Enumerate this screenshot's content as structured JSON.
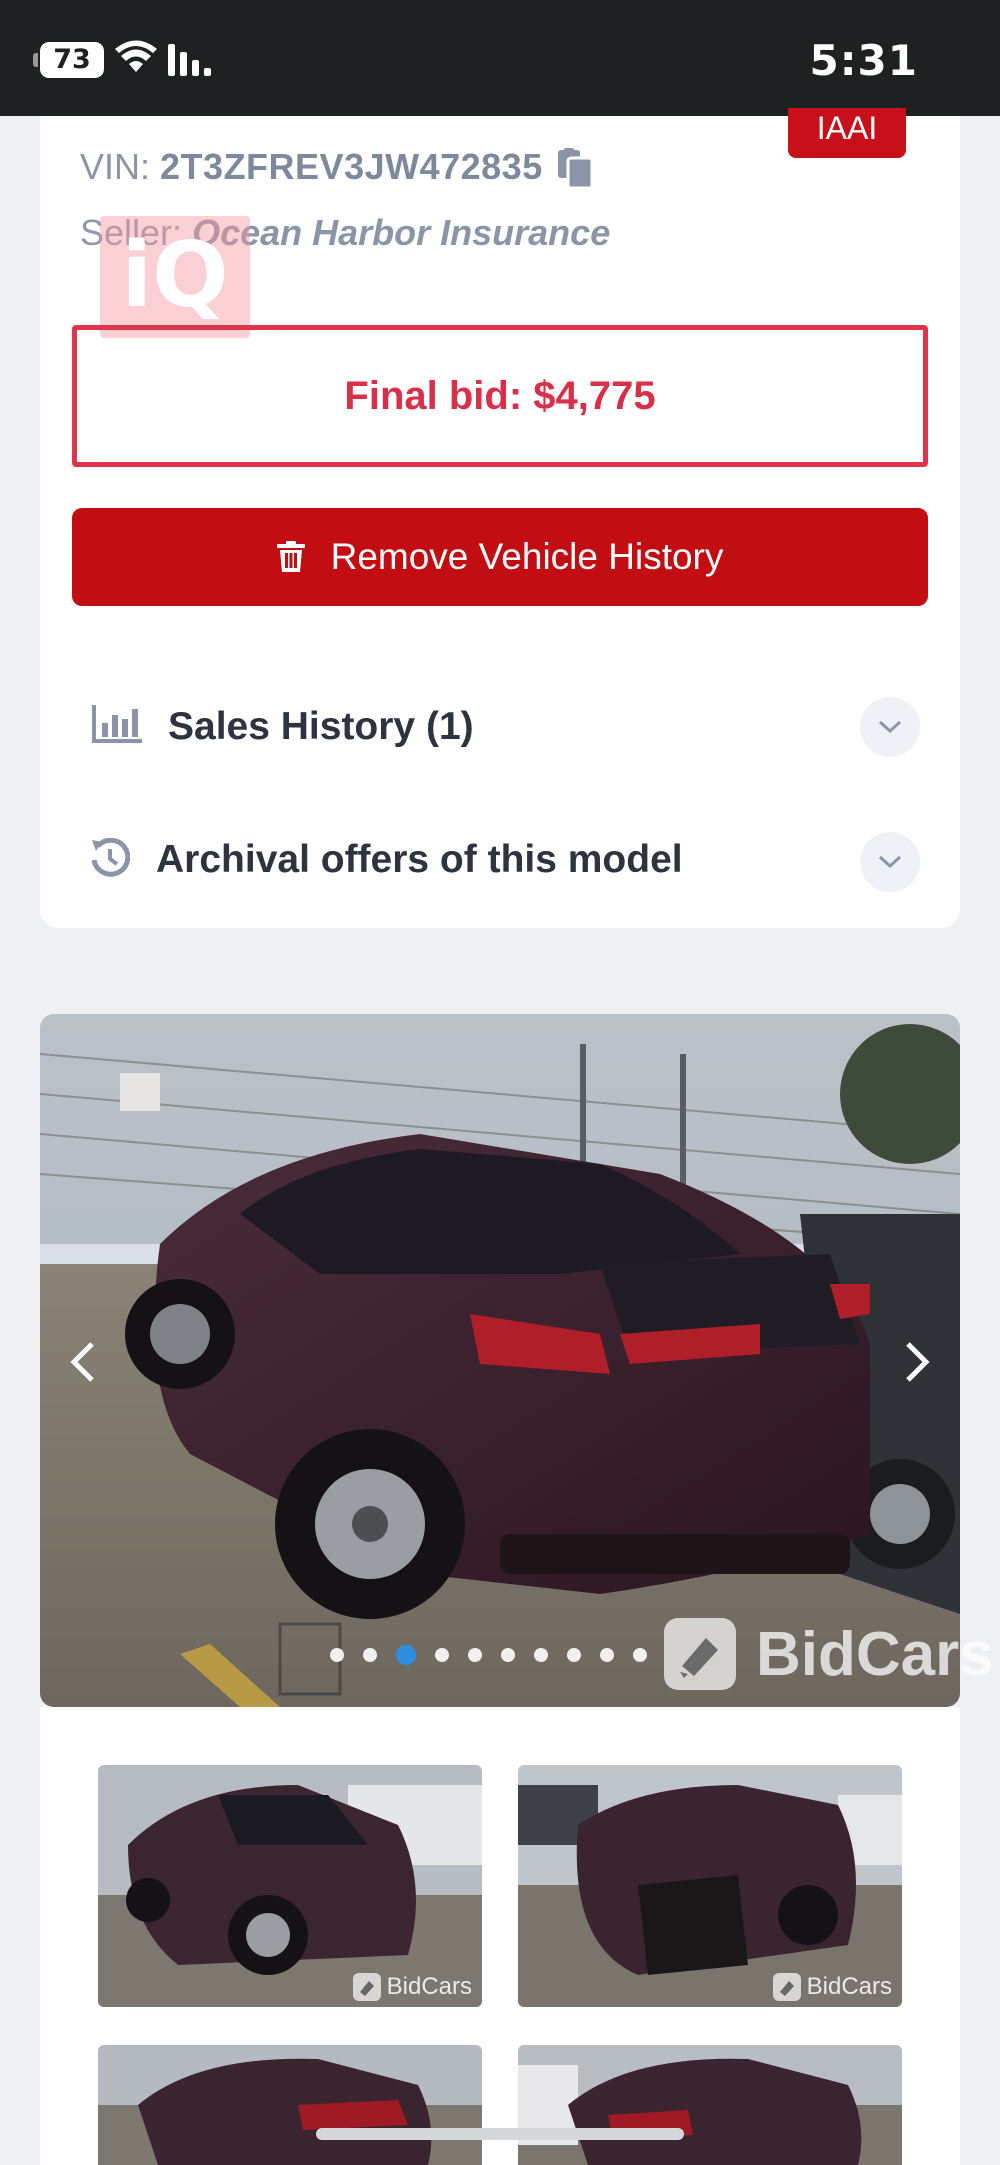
{
  "status_bar": {
    "time": "5:31",
    "battery": "73"
  },
  "vehicle": {
    "auction_badge": "IAAI",
    "vin_label": "VIN:",
    "vin": "2T3ZFREV3JW472835",
    "seller_label": "Seller:",
    "seller": "Ocean Harbor Insurance",
    "final_bid": "Final bid: $4,775",
    "watermark_logo": "iQ"
  },
  "actions": {
    "remove_history_label": "Remove Vehicle History"
  },
  "accordion": {
    "sales_history": "Sales History (1)",
    "archival_offers": "Archival offers of this model"
  },
  "gallery": {
    "watermark": "BidCars",
    "total_slides": 10,
    "active_slide": 3,
    "thumbnail_watermark": "BidCars"
  },
  "icons": {
    "copy": "copy-icon",
    "trash": "trash-icon",
    "chart": "bar-chart-icon",
    "history": "history-icon",
    "chevron": "chevron-down-icon"
  },
  "colors": {
    "accent_red": "#c20d12",
    "bid_red": "#d9304a",
    "active_dot": "#2d8fe0"
  }
}
